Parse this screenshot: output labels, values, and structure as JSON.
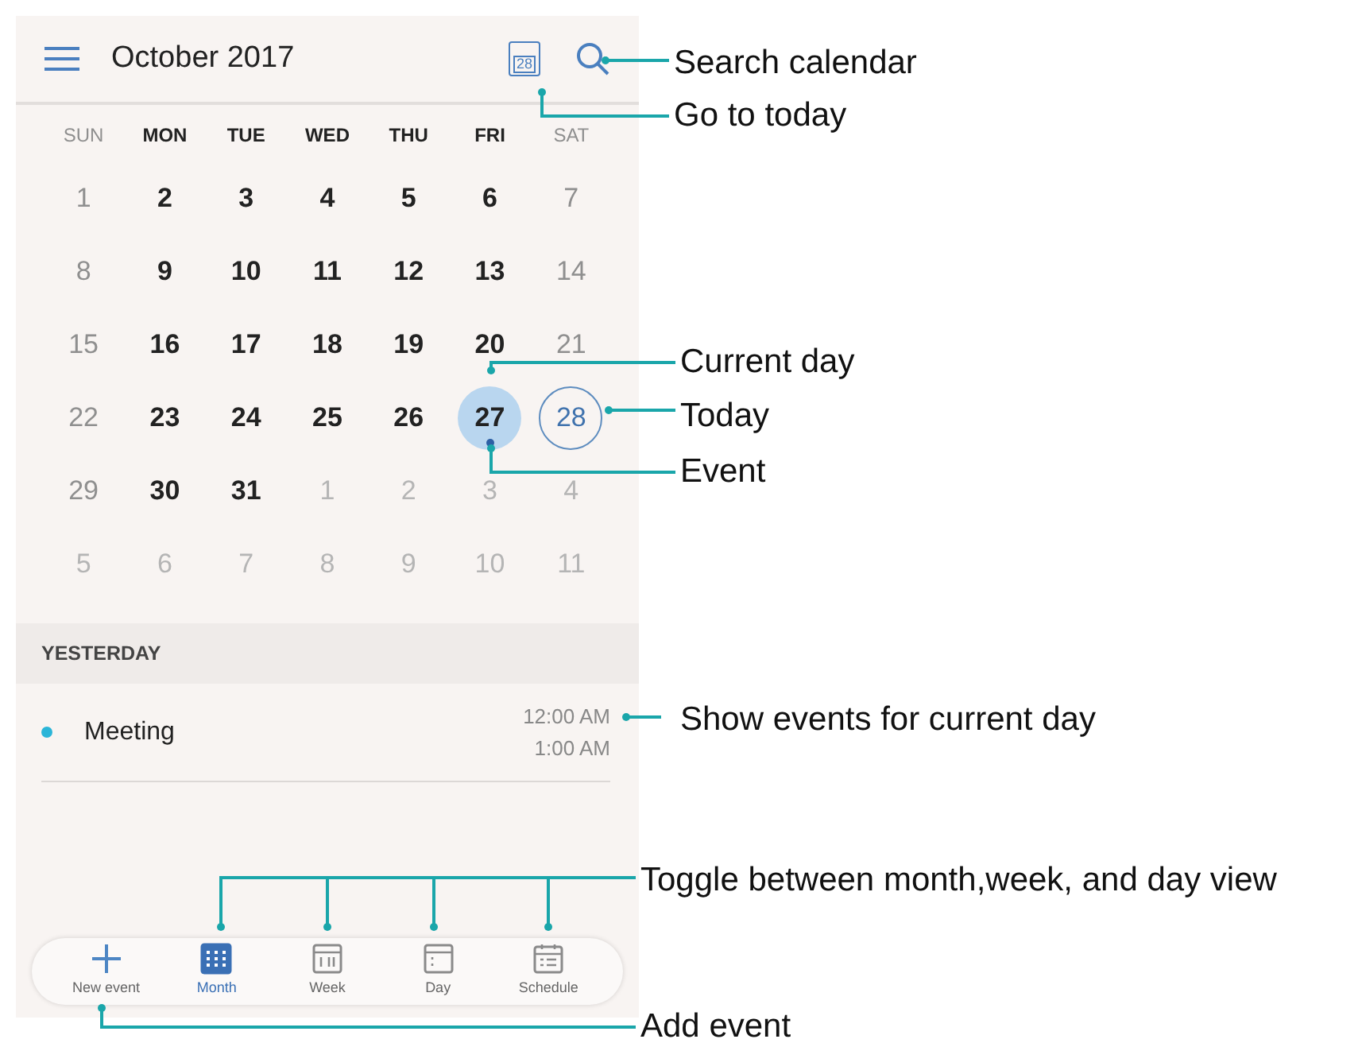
{
  "header": {
    "title": "October 2017",
    "today_icon_label": "28"
  },
  "weekdays": [
    {
      "label": "SUN",
      "kind": "weekend"
    },
    {
      "label": "MON",
      "kind": "weekday"
    },
    {
      "label": "TUE",
      "kind": "weekday"
    },
    {
      "label": "WED",
      "kind": "weekday"
    },
    {
      "label": "THU",
      "kind": "weekday"
    },
    {
      "label": "FRI",
      "kind": "weekday"
    },
    {
      "label": "SAT",
      "kind": "weekend"
    }
  ],
  "weeks": [
    [
      {
        "d": "1",
        "kind": "weekend",
        "selected": false,
        "today": false,
        "event": false
      },
      {
        "d": "2",
        "kind": "weekday",
        "selected": false,
        "today": false,
        "event": false
      },
      {
        "d": "3",
        "kind": "weekday",
        "selected": false,
        "today": false,
        "event": false
      },
      {
        "d": "4",
        "kind": "weekday",
        "selected": false,
        "today": false,
        "event": false
      },
      {
        "d": "5",
        "kind": "weekday",
        "selected": false,
        "today": false,
        "event": false
      },
      {
        "d": "6",
        "kind": "weekday",
        "selected": false,
        "today": false,
        "event": false
      },
      {
        "d": "7",
        "kind": "weekend",
        "selected": false,
        "today": false,
        "event": false
      }
    ],
    [
      {
        "d": "8",
        "kind": "weekend",
        "selected": false,
        "today": false,
        "event": false
      },
      {
        "d": "9",
        "kind": "weekday",
        "selected": false,
        "today": false,
        "event": false
      },
      {
        "d": "10",
        "kind": "weekday",
        "selected": false,
        "today": false,
        "event": false
      },
      {
        "d": "11",
        "kind": "weekday",
        "selected": false,
        "today": false,
        "event": false
      },
      {
        "d": "12",
        "kind": "weekday",
        "selected": false,
        "today": false,
        "event": false
      },
      {
        "d": "13",
        "kind": "weekday",
        "selected": false,
        "today": false,
        "event": false
      },
      {
        "d": "14",
        "kind": "weekend",
        "selected": false,
        "today": false,
        "event": false
      }
    ],
    [
      {
        "d": "15",
        "kind": "weekend",
        "selected": false,
        "today": false,
        "event": false
      },
      {
        "d": "16",
        "kind": "weekday",
        "selected": false,
        "today": false,
        "event": false
      },
      {
        "d": "17",
        "kind": "weekday",
        "selected": false,
        "today": false,
        "event": false
      },
      {
        "d": "18",
        "kind": "weekday",
        "selected": false,
        "today": false,
        "event": false
      },
      {
        "d": "19",
        "kind": "weekday",
        "selected": false,
        "today": false,
        "event": false
      },
      {
        "d": "20",
        "kind": "weekday",
        "selected": false,
        "today": false,
        "event": false
      },
      {
        "d": "21",
        "kind": "weekend",
        "selected": false,
        "today": false,
        "event": false
      }
    ],
    [
      {
        "d": "22",
        "kind": "weekend",
        "selected": false,
        "today": false,
        "event": false
      },
      {
        "d": "23",
        "kind": "weekday",
        "selected": false,
        "today": false,
        "event": false
      },
      {
        "d": "24",
        "kind": "weekday",
        "selected": false,
        "today": false,
        "event": false
      },
      {
        "d": "25",
        "kind": "weekday",
        "selected": false,
        "today": false,
        "event": false
      },
      {
        "d": "26",
        "kind": "weekday",
        "selected": false,
        "today": false,
        "event": false
      },
      {
        "d": "27",
        "kind": "weekday",
        "selected": true,
        "today": false,
        "event": true
      },
      {
        "d": "28",
        "kind": "weekend",
        "selected": false,
        "today": true,
        "event": false
      }
    ],
    [
      {
        "d": "29",
        "kind": "weekend",
        "selected": false,
        "today": false,
        "event": false
      },
      {
        "d": "30",
        "kind": "weekday",
        "selected": false,
        "today": false,
        "event": false
      },
      {
        "d": "31",
        "kind": "weekday",
        "selected": false,
        "today": false,
        "event": false
      },
      {
        "d": "1",
        "kind": "outside",
        "selected": false,
        "today": false,
        "event": false
      },
      {
        "d": "2",
        "kind": "outside",
        "selected": false,
        "today": false,
        "event": false
      },
      {
        "d": "3",
        "kind": "outside",
        "selected": false,
        "today": false,
        "event": false
      },
      {
        "d": "4",
        "kind": "outside",
        "selected": false,
        "today": false,
        "event": false
      }
    ],
    [
      {
        "d": "5",
        "kind": "outside",
        "selected": false,
        "today": false,
        "event": false
      },
      {
        "d": "6",
        "kind": "outside",
        "selected": false,
        "today": false,
        "event": false
      },
      {
        "d": "7",
        "kind": "outside",
        "selected": false,
        "today": false,
        "event": false
      },
      {
        "d": "8",
        "kind": "outside",
        "selected": false,
        "today": false,
        "event": false
      },
      {
        "d": "9",
        "kind": "outside",
        "selected": false,
        "today": false,
        "event": false
      },
      {
        "d": "10",
        "kind": "outside",
        "selected": false,
        "today": false,
        "event": false
      },
      {
        "d": "11",
        "kind": "outside",
        "selected": false,
        "today": false,
        "event": false
      }
    ]
  ],
  "agenda": {
    "heading": "YESTERDAY",
    "events": [
      {
        "title": "Meeting",
        "start": "12:00 AM",
        "end": "1:00 AM",
        "color": "#2bb5d8"
      }
    ]
  },
  "bottom_bar": [
    {
      "label": "New event",
      "kind": "add",
      "selected": false
    },
    {
      "label": "Month",
      "kind": "month",
      "selected": true
    },
    {
      "label": "Week",
      "kind": "week",
      "selected": false
    },
    {
      "label": "Day",
      "kind": "day",
      "selected": false
    },
    {
      "label": "Schedule",
      "kind": "schedule",
      "selected": false
    }
  ],
  "callouts": [
    {
      "text": "Search calendar"
    },
    {
      "text": "Go to today"
    },
    {
      "text": "Current day"
    },
    {
      "text": "Today"
    },
    {
      "text": "Event"
    },
    {
      "text": "Show events for current day"
    },
    {
      "text": "Toggle between month,week, and day view"
    },
    {
      "text": "Add event"
    }
  ]
}
